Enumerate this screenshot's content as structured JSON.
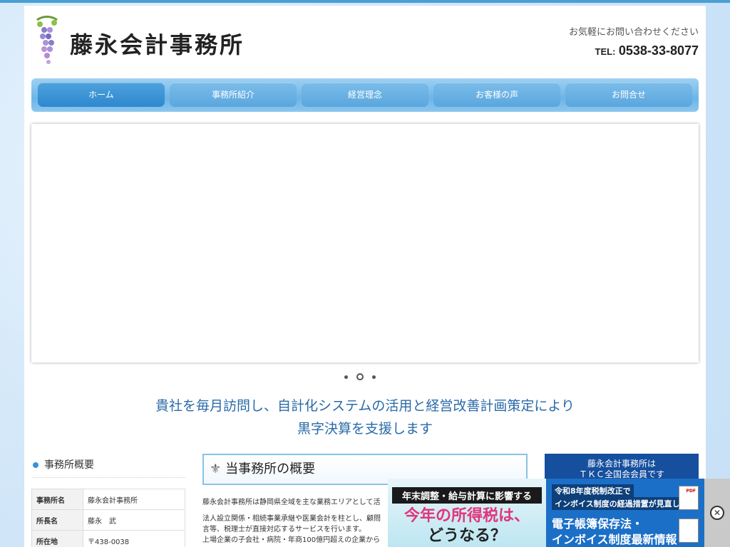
{
  "header": {
    "logo_text": "藤永会計事務所",
    "contact_lead": "お気軽にお問い合わせください",
    "tel_label": "TEL:",
    "tel_number": "0538-33-8077"
  },
  "nav": {
    "items": [
      {
        "label": "ホーム",
        "active": true
      },
      {
        "label": "事務所紹介"
      },
      {
        "label": "経営理念"
      },
      {
        "label": "お客様の声"
      },
      {
        "label": "お問合せ"
      }
    ]
  },
  "tagline": {
    "line1": "貴社を毎月訪問し、自計化システムの活用と経営改善計画策定により",
    "line2": "黒字決算を支援します"
  },
  "sidebar": {
    "title": "事務所概要",
    "rows": [
      {
        "key": "事務所名",
        "value": "藤永会計事務所"
      },
      {
        "key": "所長名",
        "value": "藤永　武"
      },
      {
        "key": "所在地",
        "value": "〒438-0038"
      }
    ]
  },
  "main": {
    "section_title": "当事務所の概要",
    "para1": "藤永会計事務所は静岡県全域を主な業務エリアとして活",
    "para2_line1": "法人設立関係・相続事業承継や医業会計を柱とし、顧問",
    "para2_line2": "言等、税理士が直接対応するサービスを行います。",
    "para2_line3": "上場企業の子会社・病院・年商100億円超えの企業から"
  },
  "tkc": {
    "line1": "藤永会計事務所は",
    "line2": "ＴＫＣ全国会会員です"
  },
  "banner": {
    "ad1_line1": "年末調整・給与計算に影響する",
    "ad1_line2": "今年の所得税は、",
    "ad1_line3": "どうなる？",
    "ad2_line1": "令和8年度税制改正で",
    "ad2_line2": "インボイス制度の経過措置が見直し",
    "ad2_line3": "電子帳簿保存法・",
    "ad2_line4": "インボイス制度最新情報",
    "ad2_pdf": "PDF",
    "close_symbol": "✕"
  },
  "colors": {
    "accent": "#3a92d4",
    "tagline": "#2a6aa8",
    "tkc_bg": "#154f9e"
  }
}
